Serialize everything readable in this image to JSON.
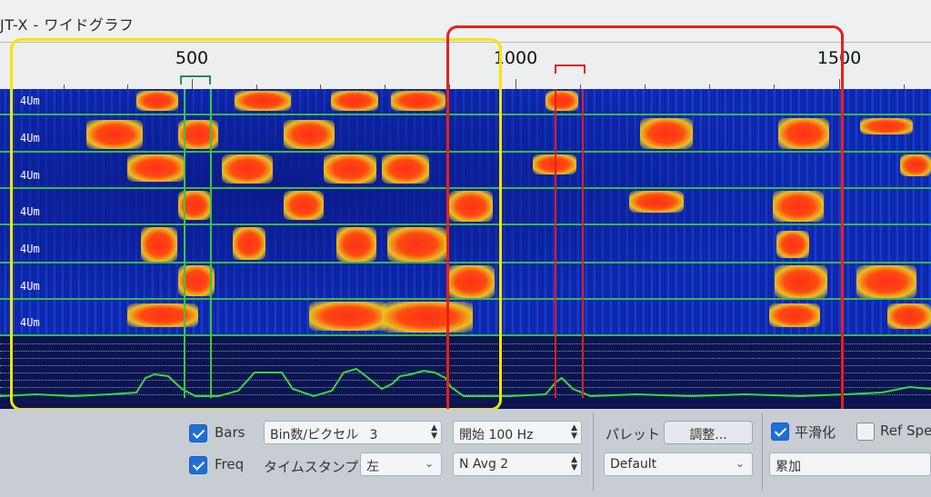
{
  "window": {
    "title": "JT-X - ワイドグラフ"
  },
  "scale": {
    "labels": [
      "500",
      "1000",
      "1500"
    ]
  },
  "waterfall": {
    "row_labels": [
      "4Um",
      "4Um",
      "4Um",
      "4Um",
      "4Um",
      "4Um",
      "4Um"
    ]
  },
  "controls": {
    "bars_label": "Bars",
    "freq_label": "Freq",
    "bins_label": "Bin数/ピクセル",
    "bins_value": "3",
    "timestamp_label": "タイムスタンプ",
    "timestamp_value": "左",
    "start_value": "開始 100 Hz",
    "navg_value": "N Avg 2",
    "palette_label": "パレット",
    "adjust_button": "調整...",
    "palette_value": "Default",
    "smooth_label": "平滑化",
    "refspec_label": "Ref Spec",
    "cumulative_value": "累加"
  },
  "colors": {
    "rx_marker": "#2a8a5a",
    "tx_marker": "#e02020",
    "yellow_box": "#f2e600",
    "red_box": "#e8201a",
    "band_line": "#3ab84a"
  }
}
